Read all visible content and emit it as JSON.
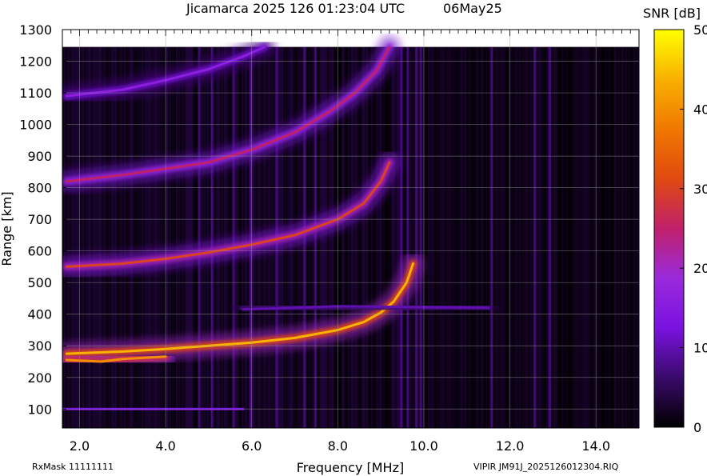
{
  "header": {
    "title": "Jicamarca 2025 126 01:23:04 UTC",
    "date": "06May25"
  },
  "footer": {
    "rxmask": "RxMask 11111111",
    "file": "VIPIR  JM91J_2025126012304.RIQ"
  },
  "chart_data": {
    "type": "heatmap",
    "xlabel": "Frequency [MHz]",
    "ylabel": "Range [km]",
    "xlim": [
      1.6,
      15.0
    ],
    "ylim": [
      40,
      1300
    ],
    "data_ymax": 1245,
    "x_ticks": [
      2.0,
      4.0,
      6.0,
      8.0,
      10.0,
      12.0,
      14.0
    ],
    "x_tick_labels": [
      "2.0",
      "4.0",
      "6.0",
      "8.0",
      "10.0",
      "12.0",
      "14.0"
    ],
    "y_ticks": [
      100,
      200,
      300,
      400,
      500,
      600,
      700,
      800,
      900,
      1000,
      1100,
      1200,
      1300
    ],
    "y_tick_labels": [
      "100",
      "200",
      "300",
      "400",
      "500",
      "600",
      "700",
      "800",
      "900",
      "1000",
      "1100",
      "1200",
      "1300"
    ],
    "grid": true,
    "colorbar": {
      "label": "SNR [dB]",
      "range": [
        0,
        50
      ],
      "ticks": [
        0,
        10,
        20,
        30,
        40,
        50
      ],
      "tick_labels": [
        "0",
        "10",
        "20",
        "30",
        "40",
        "50"
      ],
      "colors": [
        "#000000",
        "#3a0a6b",
        "#7a12e0",
        "#9a2adc",
        "#c0206a",
        "#e04a10",
        "#f07800",
        "#f8b000",
        "#ffff00"
      ]
    },
    "traces": [
      {
        "name": "E layer",
        "points": [
          [
            1.6,
            100
          ],
          [
            3.0,
            100
          ],
          [
            5.0,
            100
          ],
          [
            5.8,
            100
          ]
        ],
        "snr": 12
      },
      {
        "name": "F1 trace",
        "points": [
          [
            1.7,
            275
          ],
          [
            3.0,
            282
          ],
          [
            4.0,
            290
          ],
          [
            5.0,
            300
          ],
          [
            6.0,
            310
          ],
          [
            7.0,
            325
          ],
          [
            8.0,
            350
          ],
          [
            8.6,
            375
          ],
          [
            9.0,
            405
          ],
          [
            9.3,
            440
          ],
          [
            9.6,
            500
          ],
          [
            9.75,
            560
          ]
        ],
        "snr": 44
      },
      {
        "name": "F upper edge",
        "points": [
          [
            1.7,
            255
          ],
          [
            2.5,
            250
          ],
          [
            3.0,
            258
          ],
          [
            4.0,
            266
          ]
        ],
        "snr": 40
      },
      {
        "name": "second hop",
        "points": [
          [
            1.7,
            550
          ],
          [
            3.0,
            560
          ],
          [
            4.0,
            575
          ],
          [
            5.0,
            595
          ],
          [
            6.0,
            620
          ],
          [
            7.0,
            650
          ],
          [
            8.0,
            700
          ],
          [
            8.6,
            750
          ],
          [
            9.0,
            820
          ],
          [
            9.2,
            880
          ]
        ],
        "snr": 30
      },
      {
        "name": "third hop",
        "points": [
          [
            1.7,
            820
          ],
          [
            3.0,
            840
          ],
          [
            4.0,
            860
          ],
          [
            5.0,
            880
          ],
          [
            6.0,
            920
          ],
          [
            7.0,
            975
          ],
          [
            7.8,
            1040
          ],
          [
            8.4,
            1100
          ],
          [
            8.9,
            1170
          ],
          [
            9.2,
            1245
          ]
        ],
        "snr": 25
      },
      {
        "name": "fourth hop",
        "points": [
          [
            1.7,
            1090
          ],
          [
            3.0,
            1110
          ],
          [
            4.0,
            1140
          ],
          [
            5.0,
            1175
          ],
          [
            5.8,
            1215
          ],
          [
            6.3,
            1245
          ]
        ],
        "snr": 16
      },
      {
        "name": "spread band",
        "points": [
          [
            5.8,
            415
          ],
          [
            7.0,
            420
          ],
          [
            8.0,
            425
          ],
          [
            11.5,
            420
          ]
        ],
        "snr": 10
      }
    ],
    "interference_lines_mhz": [
      4.75,
      5.05,
      5.55,
      5.95,
      6.55,
      7.2,
      7.45,
      9.45,
      9.6,
      9.8,
      9.9,
      11.55,
      12.55,
      12.9
    ]
  }
}
